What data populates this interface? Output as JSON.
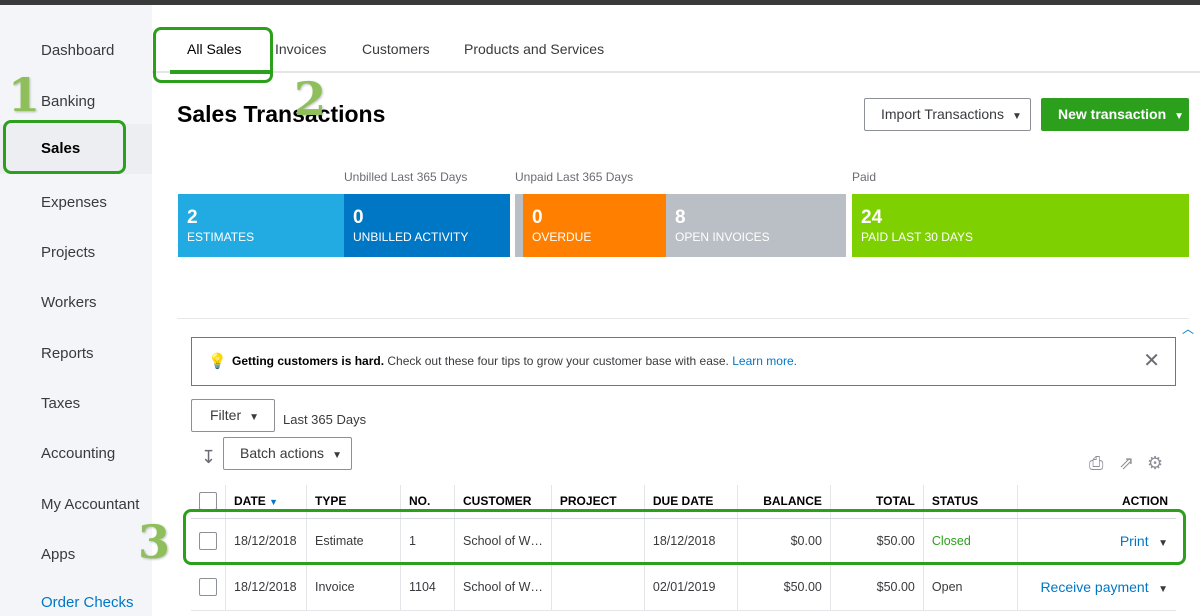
{
  "sidebar": {
    "items": [
      {
        "label": "Dashboard"
      },
      {
        "label": "Banking"
      },
      {
        "label": "Sales"
      },
      {
        "label": "Expenses"
      },
      {
        "label": "Projects"
      },
      {
        "label": "Workers"
      },
      {
        "label": "Reports"
      },
      {
        "label": "Taxes"
      },
      {
        "label": "Accounting"
      },
      {
        "label": "My Accountant"
      },
      {
        "label": "Apps"
      },
      {
        "label": "Order Checks"
      }
    ]
  },
  "tabs": [
    {
      "label": "All Sales"
    },
    {
      "label": "Invoices"
    },
    {
      "label": "Customers"
    },
    {
      "label": "Products and Services"
    }
  ],
  "page": {
    "title": "Sales Transactions",
    "import_button": "Import Transactions",
    "new_button": "New transaction"
  },
  "stats": {
    "headers": {
      "unbilled": "Unbilled Last 365 Days",
      "unpaid": "Unpaid Last 365 Days",
      "paid": "Paid"
    },
    "cards": [
      {
        "num": "2",
        "label": "ESTIMATES",
        "color": "#21abe2"
      },
      {
        "num": "0",
        "label": "UNBILLED ACTIVITY",
        "color": "#0077c5"
      },
      {
        "num": "0",
        "label": "OVERDUE",
        "color": "#ff8000"
      },
      {
        "num": "8",
        "label": "OPEN INVOICES",
        "color": "#babec5"
      },
      {
        "num": "24",
        "label": "PAID LAST 30 DAYS",
        "color": "#7fd000"
      }
    ]
  },
  "tip": {
    "bold": "Getting customers is hard.",
    "text": "Check out these four tips to grow your customer base with ease.",
    "link": "Learn more."
  },
  "filter": {
    "button": "Filter",
    "range": "Last 365 Days",
    "batch": "Batch actions"
  },
  "table": {
    "headers": {
      "date": "DATE",
      "type": "TYPE",
      "no": "NO.",
      "customer": "CUSTOMER",
      "project": "PROJECT",
      "due": "DUE DATE",
      "balance": "BALANCE",
      "total": "TOTAL",
      "status": "STATUS",
      "action": "ACTION"
    },
    "rows": [
      {
        "date": "18/12/2018",
        "type": "Estimate",
        "no": "1",
        "customer": "School of W…",
        "project": "",
        "due": "18/12/2018",
        "balance": "$0.00",
        "total": "$50.00",
        "status": "Closed",
        "action": "Print"
      },
      {
        "date": "18/12/2018",
        "type": "Invoice",
        "no": "1104",
        "customer": "School of W…",
        "project": "",
        "due": "02/01/2019",
        "balance": "$50.00",
        "total": "$50.00",
        "status": "Open",
        "action": "Receive payment"
      }
    ]
  },
  "annotations": {
    "one": "1",
    "two": "2",
    "three": "3"
  },
  "colors": {
    "accent": "#2ca01c",
    "link": "#0077c5",
    "annotation": "#8fbf5a"
  }
}
